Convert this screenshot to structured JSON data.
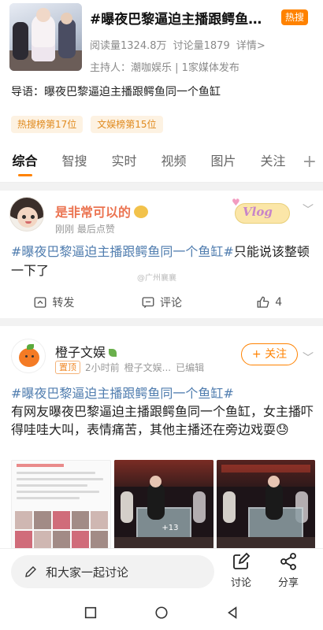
{
  "topic": {
    "title": "#曝夜巴黎逼迫主播跟鳄鱼同一个鱼缸#",
    "hot_badge": "热搜",
    "reads": "阅读量1324.8万",
    "discussions": "讨论量1879",
    "detail_link": "详情>",
    "host": "主持人：潮咖娱乐 | 1家媒体发布",
    "guide": "导语：曝夜巴黎逼迫主播跟鳄鱼同一个鱼缸",
    "rank_tags": [
      "热搜榜第17位",
      "文娱榜第15位"
    ]
  },
  "tabs": [
    "综合",
    "智搜",
    "实时",
    "视频",
    "图片",
    "关注"
  ],
  "post1": {
    "username": "是非常可以的",
    "meta": "刚刚  最后点赞",
    "sticker": "Vlog",
    "hashtag": "#曝夜巴黎逼迫主播跟鳄鱼同一个鱼缸#",
    "text": "只能说该整顿一下了",
    "watermark": "@广州襄襄",
    "repost_label": "转发",
    "comment_label": "评论",
    "like_count": "4"
  },
  "post2": {
    "username": "橙子文娱",
    "pinned": "置顶",
    "time": "2小时前",
    "source": "橙子文娱...",
    "edited": "已编辑",
    "follow": "+ 关注",
    "hashtag": "#曝夜巴黎逼迫主播跟鳄鱼同一个鱼缸#",
    "text": "有网友曝夜巴黎逼迫主播跟鳄鱼同一个鱼缸，女主播吓得哇哇大叫，表情痛苦，其他主播还在旁边戏耍😓",
    "thumb_count": "+13"
  },
  "bottom_bar": {
    "input_placeholder": "和大家一起讨论",
    "comment_label": "讨论",
    "share_label": "分享"
  },
  "icons": {
    "tab_plus": "+",
    "chevron": "﹀"
  },
  "colors": {
    "accent": "#ff8200",
    "hashtag": "#507daf",
    "username_vip": "#eb7350"
  }
}
